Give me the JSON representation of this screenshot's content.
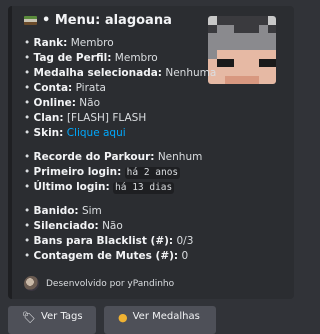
{
  "embed": {
    "title": "• Menu: alagoana",
    "fields": {
      "rank": {
        "label": "Rank:",
        "value": " Membro"
      },
      "tag": {
        "label": "Tag de Perfil:",
        "value": " Membro"
      },
      "medal": {
        "label": "Medalha selecionada:",
        "value": " Nenhuma"
      },
      "account": {
        "label": "Conta:",
        "value": " Pirata"
      },
      "online": {
        "label": "Online:",
        "value": " Não"
      },
      "clan": {
        "label": "Clan:",
        "value": " [FLASH] FLASH"
      },
      "skin": {
        "label": "Skin:",
        "value": "Clique aqui"
      },
      "parkour": {
        "label": "Recorde do Parkour:",
        "value": " Nenhum"
      },
      "first_login": {
        "label": "Primeiro login:",
        "value": "há 2 anos"
      },
      "last_login": {
        "label": "Último login:",
        "value": "há 13 dias"
      },
      "banned": {
        "label": "Banido:",
        "value": " Sim"
      },
      "muted": {
        "label": "Silenciado:",
        "value": " Não"
      },
      "blacklist": {
        "label": "Bans para Blacklist (#):",
        "value": " 0/3"
      },
      "mutes": {
        "label": "Contagem de Mutes (#):",
        "value": " 0"
      }
    },
    "footer": "Desenvolvido por yPandinho"
  },
  "buttons": {
    "tags": "Ver Tags",
    "medals": "Ver Medalhas"
  },
  "colors": {
    "background": "#313338",
    "embed_bg": "#2b2d31",
    "link": "#00a8fc",
    "button": "#4e5058"
  },
  "icons": [
    "flag-icon",
    "skin-thumbnail",
    "footer-avatar-icon",
    "tag-icon",
    "medal-icon"
  ]
}
